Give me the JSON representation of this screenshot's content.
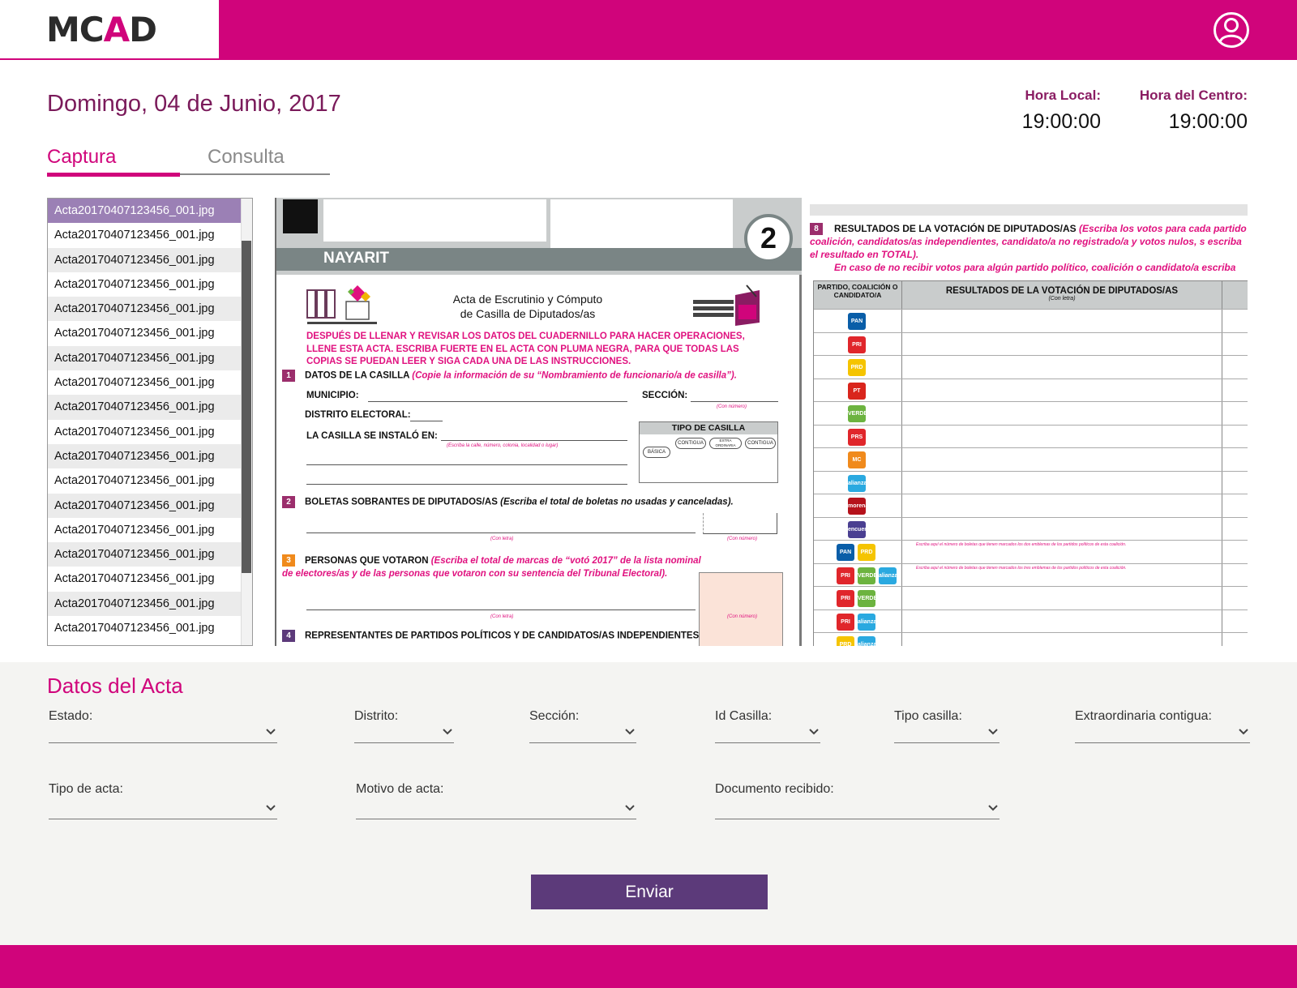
{
  "header": {
    "logo_prefix": "MC",
    "logo_accent": "A",
    "logo_suffix": "D",
    "brand_color": "#d0047b",
    "user_icon": "user-circle-icon"
  },
  "date": "Domingo, 04 de Junio, 2017",
  "clocks": {
    "local_label": "Hora Local:",
    "local_value": "19:00:00",
    "centro_label": "Hora del Centro:",
    "centro_value": "19:00:00"
  },
  "tabs": [
    {
      "label": "Captura",
      "active": true
    },
    {
      "label": "Consulta",
      "active": false
    }
  ],
  "files": [
    "Acta20170407123456_001.jpg",
    "Acta20170407123456_001.jpg",
    "Acta20170407123456_001.jpg",
    "Acta20170407123456_001.jpg",
    "Acta20170407123456_001.jpg",
    "Acta20170407123456_001.jpg",
    "Acta20170407123456_001.jpg",
    "Acta20170407123456_001.jpg",
    "Acta20170407123456_001.jpg",
    "Acta20170407123456_001.jpg",
    "Acta20170407123456_001.jpg",
    "Acta20170407123456_001.jpg",
    "Acta20170407123456_001.jpg",
    "Acta20170407123456_001.jpg",
    "Acta20170407123456_001.jpg",
    "Acta20170407123456_001.jpg",
    "Acta20170407123456_001.jpg",
    "Acta20170407123456_001.jpg"
  ],
  "selected_file_index": 0,
  "document": {
    "estado": "NAYARIT",
    "number": "2",
    "title": "Acta de Escrutinio y Cómputo de Casilla de Diputados/as",
    "warning": "DESPUÉS DE LLENAR Y REVISAR LOS DATOS DEL CUADERNILLO PARA HACER OPERACIONES, LLENE ESTA ACTA. ESCRIBA FUERTE EN EL ACTA CON PLUMA NEGRA, PARA QUE TODAS LAS COPIAS SE PUEDAN LEER Y SIGA CADA UNA DE LAS INSTRUCCIONES.",
    "sec1_title": "DATOS DE LA CASILLA",
    "sec1_note": "(Copie la información de su “Nombramiento de funcionario/a de casilla”).",
    "municipio": "MUNICIPIO:",
    "seccion": "SECCIÓN:",
    "con_numero": "(Con número)",
    "distrito": "DISTRITO ELECTORAL:",
    "instalo": "LA CASILLA SE INSTALÓ EN:",
    "instalo_note": "(Escriba la calle, número, colonia, localidad o lugar)",
    "tipo_casilla": "TIPO  DE  CASILLA",
    "tipo_opts": [
      "BÁSICA",
      "CONTIGUA",
      "EXTRA ORDINARIA",
      "CONTIGUA"
    ],
    "sec2_title": "BOLETAS SOBRANTES DE DIPUTADOS/AS",
    "sec2_note": "(Escriba el total de boletas no usadas y canceladas).",
    "con_letra": "(Con letra)",
    "sec3_title": "PERSONAS QUE VOTARON",
    "sec3_note": "(Escriba el total de marcas de “votó 2017” de la lista nominal de electores/as y de las personas que votaron con su sentencia del Tribunal Electoral).",
    "sec4_title": "REPRESENTANTES DE PARTIDOS POLÍTICOS Y DE CANDIDATOS/AS INDEPENDIENTES",
    "sec8_num": "8",
    "sec8_title": "RESULTADOS DE LA VOTACIÓN DE DIPUTADOS/AS",
    "sec8_note": "(Escriba los votos para cada partido coalición, candidatos/as independientes, candidato/a no registrado/a y votos nulos, s escriba el resultado en TOTAL).",
    "sec8_note2": "En caso de no recibir votos para algún partido político, coalición o candidato/a escriba",
    "table_col1": "PARTIDO, COALICIÓN O CANDIDATO/A",
    "table_col2": "RESULTADOS DE LA VOTACIÓN DE DIPUTADOS/AS",
    "table_col2_sub": "(Con letra)",
    "parties": [
      {
        "label": "PAN",
        "color": "#0a5ea8"
      },
      {
        "label": "PRI",
        "color": "#e0262b"
      },
      {
        "label": "PRD",
        "color": "#f5c400"
      },
      {
        "label": "PT",
        "color": "#d9251c"
      },
      {
        "label": "VERDE",
        "color": "#6cb33f"
      },
      {
        "label": "PRS",
        "color": "#e0262b"
      },
      {
        "label": "MC",
        "color": "#f08a1c"
      },
      {
        "label": "alianza",
        "color": "#2aa9e0"
      },
      {
        "label": "morena",
        "color": "#b5121b"
      },
      {
        "label": "encuentro",
        "color": "#4a3f91"
      }
    ],
    "coal_note_2": "Escriba aquí el número de boletas que tienen marcados los dos emblemas de los partidos políticos de esta coalición.",
    "coal_note_3": "Escriba aquí el número de boletas que tienen marcados los tres emblemas de los partidos políticos de esta coalición."
  },
  "form": {
    "title": "Datos del Acta",
    "fields_row1": [
      "Estado:",
      "Distrito:",
      "Sección:",
      "Id Casilla:",
      "Tipo casilla:",
      "Extraordinaria contigua:"
    ],
    "fields_row2": [
      "Tipo de acta:",
      "Motivo de acta:",
      "Documento recibido:"
    ],
    "submit_label": "Enviar",
    "submit_color": "#5c3a7a"
  }
}
